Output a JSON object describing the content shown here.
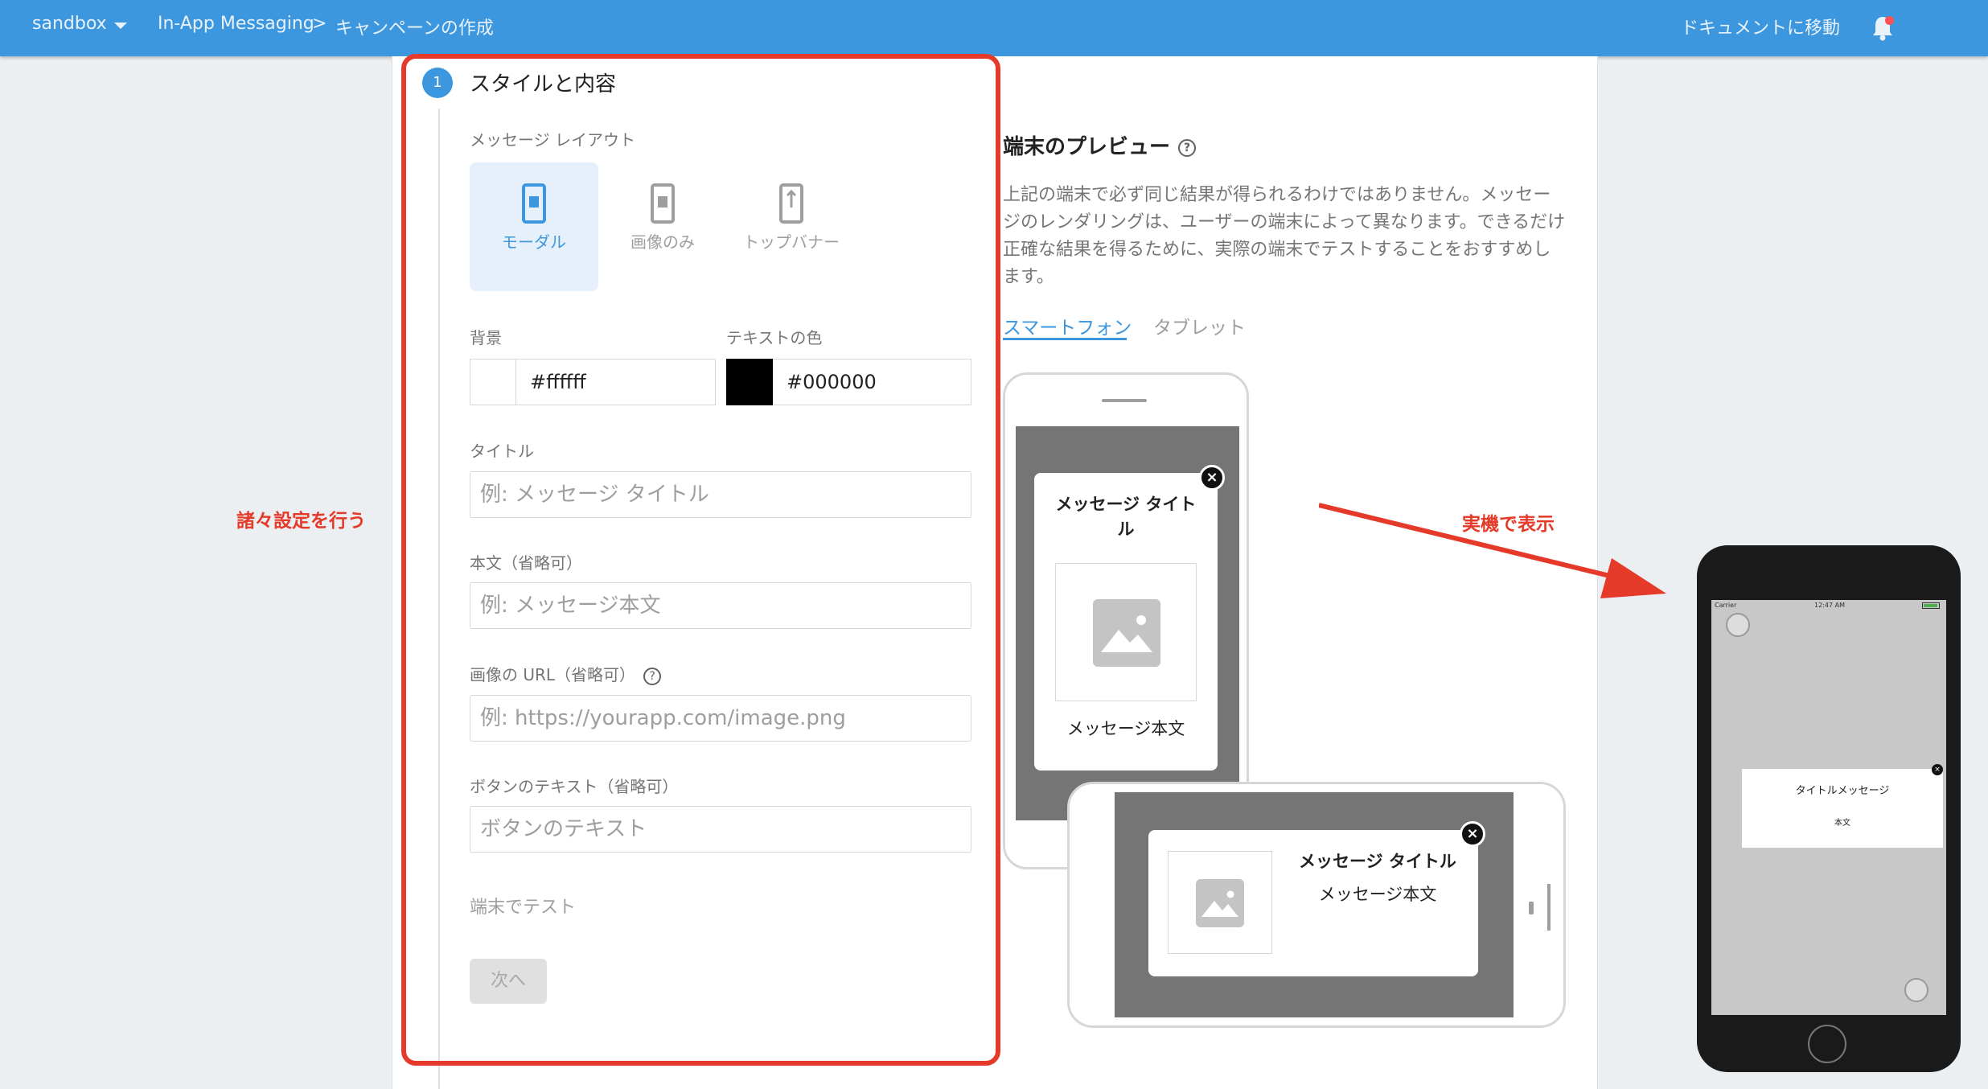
{
  "header": {
    "project": "sandbox",
    "product": "In-App Messaging",
    "separator": ">",
    "page": "キャンペーンの作成",
    "docs_link": "ドキュメントに移動"
  },
  "step": {
    "number": "1",
    "title": "スタイルと内容"
  },
  "layout_section": {
    "label": "メッセージ レイアウト",
    "options": [
      {
        "label": "モーダル",
        "selected": true,
        "icon": "phone-modal-icon"
      },
      {
        "label": "画像のみ",
        "selected": false,
        "icon": "phone-image-icon"
      },
      {
        "label": "トップバナー",
        "selected": false,
        "icon": "phone-banner-icon"
      }
    ]
  },
  "colors": {
    "bg_label": "背景",
    "bg_value": "#ffffff",
    "text_label": "テキストの色",
    "text_value": "#000000",
    "accent": "#3d97de",
    "annotation_red": "#e53a2a"
  },
  "fields": {
    "title_label": "タイトル",
    "title_placeholder": "例: メッセージ タイトル",
    "body_label": "本文（省略可）",
    "body_placeholder": "例: メッセージ本文",
    "image_label": "画像の URL（省略可）",
    "image_placeholder": "例: https://yourapp.com/image.png",
    "button_label": "ボタンのテキスト（省略可）",
    "button_placeholder": "ボタンのテキスト"
  },
  "test_label": "端末でテスト",
  "next_button": "次へ",
  "annotations": {
    "left": "諸々設定を行う",
    "right": "実機で表示"
  },
  "preview": {
    "title": "端末のプレビュー",
    "help": "?",
    "description": "上記の端末で必ず同じ結果が得られるわけではありません。メッセージのレンダリングは、ユーザーの端末によって異なります。できるだけ正確な結果を得るために、実際の端末でテストすることをおすすめします。",
    "tabs": [
      "スマートフォン",
      "タブレット"
    ],
    "active_tab": "スマートフォン",
    "phone_modal_title": "メッセージ タイトル",
    "phone_modal_body": "メッセージ本文",
    "tablet_modal_title": "メッセージ タイトル",
    "tablet_modal_body": "メッセージ本文"
  },
  "real_device": {
    "carrier": "Carrier",
    "time": "12:47 AM",
    "modal_title": "タイトルメッセージ",
    "modal_body": "本文"
  }
}
